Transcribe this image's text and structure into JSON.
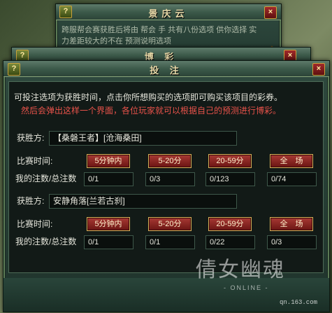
{
  "back_window": {
    "title": "景庆云",
    "text": "跨服帮会赛获胜后将由 帮会 手 共有八份选项 供你选择 实力差距较大的不在 预测说明选项"
  },
  "middle_window": {
    "title": "博 彩"
  },
  "main_window": {
    "title": "投 注",
    "intro": "可投注选项为获胜时间，点击你所想购买的选项即可购买该项目的彩券。",
    "intro_red": "然后会弹出这样一个界面，各位玩家就可以根据自己的预测进行博彩。",
    "time_label": "比赛时间:",
    "count_label": "我的注数/总注数",
    "winner_label": "获胜方:",
    "time_options": [
      "5分钟内",
      "5-20分",
      "20-59分",
      "全　场"
    ],
    "matches": [
      {
        "team": "【桑磐王者】[沧海桑田]",
        "counts": [
          "0/1",
          "0/3",
          "0/123",
          "0/74"
        ]
      },
      {
        "team": "安静角落[兰若古刹]",
        "counts": [
          "0/1",
          "0/1",
          "0/22",
          "0/3"
        ]
      }
    ]
  },
  "watermark": {
    "logo": "倩女幽魂",
    "sub": "- ONLINE -",
    "url": "qn.163.com"
  }
}
